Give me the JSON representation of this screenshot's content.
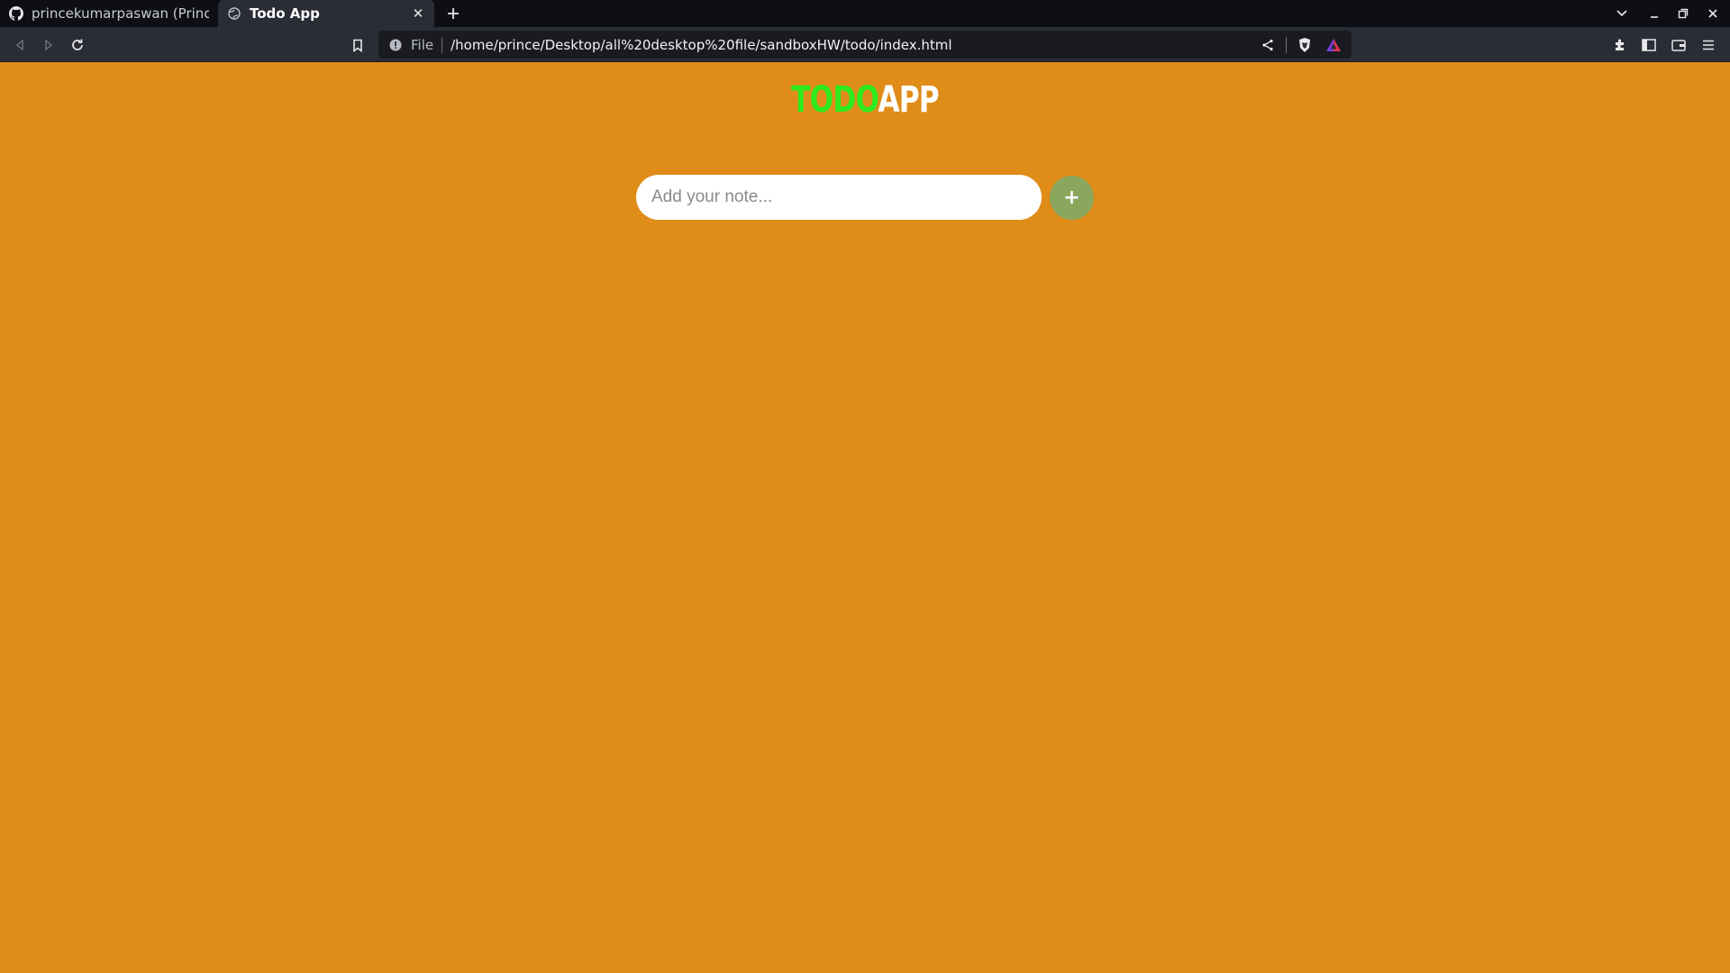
{
  "browser": {
    "tabs": [
      {
        "title": "princekumarpaswan (Prince K",
        "icon": "github-icon",
        "active": false
      },
      {
        "title": "Todo App",
        "icon": "globe-icon",
        "active": true
      }
    ],
    "address_bar": {
      "scheme_label": "File",
      "url": "/home/prince/Desktop/all%20desktop%20file/sandboxHW/todo/index.html"
    }
  },
  "app": {
    "logo": {
      "part1": "TODO",
      "part2": "APP"
    },
    "note_input": {
      "placeholder": "Add your note...",
      "value": ""
    },
    "add_button_label": "+"
  },
  "colors": {
    "page_background": "#df8c18",
    "logo_accent": "#2eea1e",
    "add_button": "#8ba65d"
  }
}
